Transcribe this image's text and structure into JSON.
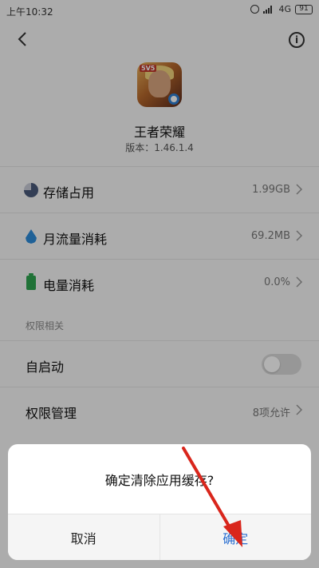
{
  "status": {
    "time": "上午10:32",
    "network": "4G",
    "battery": "91"
  },
  "app": {
    "name": "王者荣耀",
    "version": "版本：1.46.1.4",
    "icon_badge": "5V5"
  },
  "rows": {
    "storage": {
      "label": "存储占用",
      "value": "1.99GB"
    },
    "data": {
      "label": "月流量消耗",
      "value": "69.2MB"
    },
    "power": {
      "label": "电量消耗",
      "value": "0.0%"
    }
  },
  "permissions": {
    "section_title": "权限相关",
    "autostart": {
      "label": "自启动",
      "enabled": false
    },
    "manage": {
      "label": "权限管理",
      "value": "8项允许"
    }
  },
  "dialog": {
    "message": "确定清除应用缓存?",
    "cancel": "取消",
    "confirm": "确定"
  },
  "colors": {
    "accent": "#2b6fd1",
    "annotation_arrow": "#d9261c"
  }
}
